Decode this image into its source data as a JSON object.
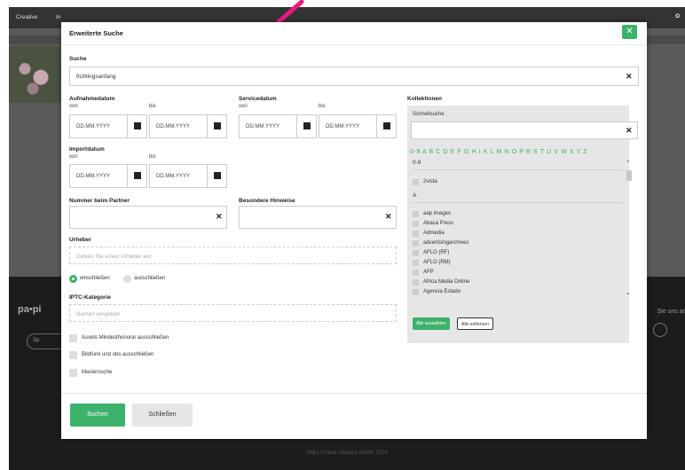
{
  "background": {
    "topbar_left": "Creative",
    "topbar_second": "In",
    "topbar_right": "O",
    "logo_text": "pa•pi",
    "pill_text": "Sp",
    "right_text": "Sie uns ar",
    "footer_text": "©dpa Picture-Alliance GmbH 2020"
  },
  "modal": {
    "title": "Erweiterte Suche",
    "close_label": "✕",
    "suche": {
      "label": "Suche",
      "value": "frühlingsanfang"
    },
    "aufnahmedatum": {
      "label": "Aufnahmedatum",
      "von": "von",
      "bis": "bis",
      "from_placeholder": "DD.MM.YYYY",
      "to_placeholder": "DD.MM.YYYY"
    },
    "servicedatum": {
      "label": "Servicedatum",
      "von": "von",
      "bis": "bis",
      "from_placeholder": "DD.MM.YYYY",
      "to_placeholder": "DD.MM.YYYY"
    },
    "importdatum": {
      "label": "Importdatum",
      "von": "von",
      "bis": "bis",
      "from_placeholder": "DD.MM.YYYY",
      "to_placeholder": "DD.MM.YYYY"
    },
    "nummer": {
      "label": "Nummer beim Partner",
      "value": ""
    },
    "hinweise": {
      "label": "Besondere Hinweise",
      "value": ""
    },
    "urheber": {
      "label": "Urheber",
      "placeholder": "Geben Sie einen Urheber ein"
    },
    "radio": {
      "include": "einschließen",
      "exclude": "ausschließen"
    },
    "iptc": {
      "label": "IPTC-Kategorie",
      "placeholder": "Namen eingeben"
    },
    "checkboxes": [
      "Assets Mindesthonorar ausschließen",
      "Bildfunk und obs ausschließen",
      "Mastersuche"
    ],
    "kollektionen": {
      "label": "Kollektionen",
      "schnellsuche": "Schnellsuche",
      "alphabet": "0-9 A B C D E F G H I K L M N O P R S T U V W X Y Z",
      "section_09": "0-9",
      "items_09": [
        "2vista"
      ],
      "section_a": "A",
      "items_a": [
        "aap images",
        "Abaca Press",
        "Admedia",
        "advertisingarchives",
        "AFLO (RF)",
        "AFLO (RM)",
        "AFP",
        "Africa Media Online",
        "Agencia Estado"
      ],
      "btn_all_select": "Alle auswählen",
      "btn_all_remove": "Alle entfernen"
    },
    "footer": {
      "search": "Suchen",
      "close": "Schließen"
    }
  },
  "colors": {
    "accent": "#3db26b",
    "annotation_arrow": "#e8197f"
  }
}
